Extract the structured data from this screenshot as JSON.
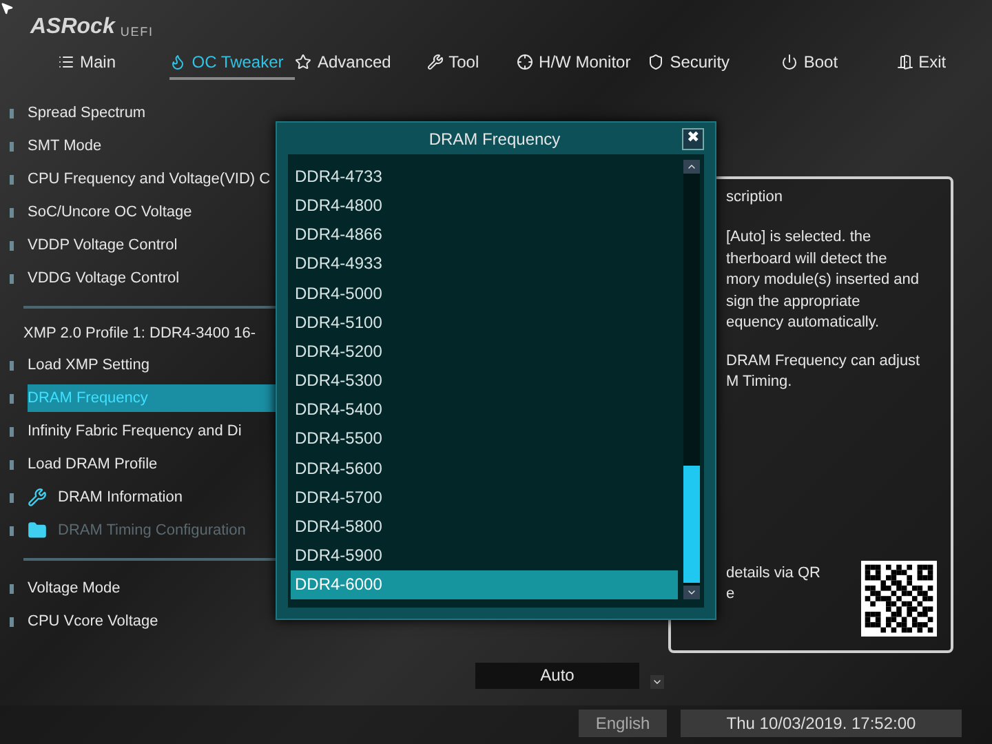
{
  "logo": {
    "brand": "ASRock",
    "suffix": "UEFI"
  },
  "tabs": [
    {
      "label": "Main",
      "selected": false
    },
    {
      "label": "OC Tweaker",
      "selected": true
    },
    {
      "label": "Advanced",
      "selected": false
    },
    {
      "label": "Tool",
      "selected": false
    },
    {
      "label": "H/W Monitor",
      "selected": false
    },
    {
      "label": "Security",
      "selected": false
    },
    {
      "label": "Boot",
      "selected": false
    },
    {
      "label": "Exit",
      "selected": false
    }
  ],
  "settings": [
    {
      "kind": "item",
      "label": "Spread Spectrum",
      "selected": false,
      "disabled": false
    },
    {
      "kind": "item",
      "label": "SMT Mode",
      "selected": false,
      "disabled": false
    },
    {
      "kind": "item",
      "label": "CPU Frequency and Voltage(VID) C",
      "selected": false,
      "disabled": false
    },
    {
      "kind": "item",
      "label": "SoC/Uncore OC Voltage",
      "selected": false,
      "disabled": false
    },
    {
      "kind": "item",
      "label": "VDDP Voltage Control",
      "selected": false,
      "disabled": false
    },
    {
      "kind": "item",
      "label": "VDDG Voltage Control",
      "selected": false,
      "disabled": false
    },
    {
      "kind": "divider"
    },
    {
      "kind": "info",
      "label": "XMP 2.0 Profile 1: DDR4-3400 16-"
    },
    {
      "kind": "item",
      "label": "Load XMP Setting",
      "selected": false,
      "disabled": false
    },
    {
      "kind": "item",
      "label": "DRAM Frequency",
      "selected": true,
      "disabled": false
    },
    {
      "kind": "item",
      "label": "Infinity Fabric Frequency and Di",
      "selected": false,
      "disabled": false
    },
    {
      "kind": "item",
      "label": "Load DRAM Profile",
      "selected": false,
      "disabled": false
    },
    {
      "kind": "tools",
      "label": "DRAM Information",
      "selected": false,
      "disabled": false
    },
    {
      "kind": "folder",
      "label": "DRAM Timing Configuration",
      "selected": false,
      "disabled": true
    },
    {
      "kind": "divider"
    },
    {
      "kind": "item",
      "label": "Voltage Mode",
      "selected": false,
      "disabled": false
    },
    {
      "kind": "item",
      "label": "CPU Vcore Voltage",
      "selected": false,
      "disabled": false
    }
  ],
  "value_field": "Auto",
  "description": {
    "title": "scription",
    "paragraphs": [
      [
        "[Auto] is selected. the",
        "therboard will detect the",
        "mory module(s) inserted and",
        "sign the appropriate",
        "equency automatically."
      ],
      [
        "DRAM Frequency can adjust",
        "M Timing."
      ]
    ],
    "qr_caption": [
      "details via QR",
      "e"
    ]
  },
  "dialog": {
    "title": "DRAM Frequency",
    "close": "✖",
    "options": [
      {
        "label": "DDR4-4733",
        "selected": false
      },
      {
        "label": "DDR4-4800",
        "selected": false
      },
      {
        "label": "DDR4-4866",
        "selected": false
      },
      {
        "label": "DDR4-4933",
        "selected": false
      },
      {
        "label": "DDR4-5000",
        "selected": false
      },
      {
        "label": "DDR4-5100",
        "selected": false
      },
      {
        "label": "DDR4-5200",
        "selected": false
      },
      {
        "label": "DDR4-5300",
        "selected": false
      },
      {
        "label": "DDR4-5400",
        "selected": false
      },
      {
        "label": "DDR4-5500",
        "selected": false
      },
      {
        "label": "DDR4-5600",
        "selected": false
      },
      {
        "label": "DDR4-5700",
        "selected": false
      },
      {
        "label": "DDR4-5800",
        "selected": false
      },
      {
        "label": "DDR4-5900",
        "selected": false
      },
      {
        "label": "DDR4-6000",
        "selected": true
      }
    ]
  },
  "status_bar": {
    "language": "English",
    "datetime": "Thu 10/03/2019. 17:52:00"
  }
}
